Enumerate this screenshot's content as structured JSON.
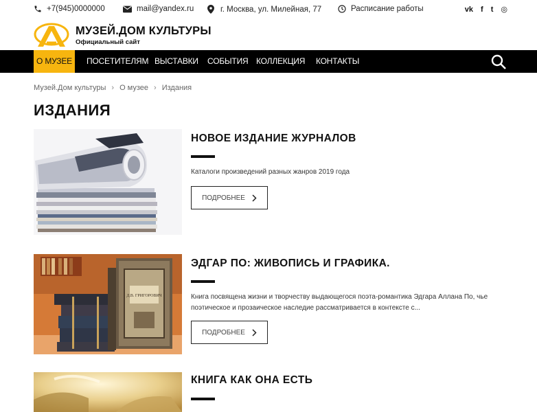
{
  "contacts": {
    "phone": "+7(945)0000000",
    "email": "mail@yandex.ru",
    "address": "г. Москва, ул. Милейная, 77",
    "schedule": "Расписание работы"
  },
  "social": [
    "vk-icon",
    "facebook-icon",
    "twitter-icon",
    "instagram-icon"
  ],
  "social_glyphs": {
    "vk": "vk",
    "fb": "f",
    "tw": "t",
    "ig": "◎"
  },
  "logo": {
    "title": "МУЗЕЙ.ДОМ КУЛЬТУРЫ",
    "subtitle": "Официальный сайт",
    "accent_color": "#f7b50f"
  },
  "nav": {
    "items": [
      {
        "label": "О МУЗЕЕ",
        "active": true
      },
      {
        "label": "ПОСЕТИТЕЛЯМ",
        "active": false
      },
      {
        "label": "ВЫСТАВКИ",
        "active": false
      },
      {
        "label": "СОБЫТИЯ",
        "active": false
      },
      {
        "label": "КОЛЛЕКЦИЯ",
        "active": false
      },
      {
        "label": "КОНТАКТЫ",
        "active": false
      }
    ],
    "search_icon": "search-icon"
  },
  "breadcrumbs": [
    "Музей.Дом культуры",
    "О музее",
    "Издания"
  ],
  "page_title": "ИЗДАНИЯ",
  "cards": [
    {
      "title": "НОВОЕ ИЗДАНИЕ ЖУРНАЛОВ",
      "description": "Каталоги произведений разных жанров 2019 года",
      "button": "ПОДРОБНЕЕ"
    },
    {
      "title": "ЭДГАР ПО: ЖИВОПИСЬ И ГРАФИКА.",
      "description": "Книга посвящена жизни и творчеству выдающегося поэта-романтика Эдгара Аллана По, чье поэтическое и прозаическое наследие рассматривается в контексте с...",
      "button": "ПОДРОБНЕЕ"
    },
    {
      "title": "КНИГА КАК ОНА ЕСТЬ",
      "description": "",
      "button": ""
    }
  ],
  "book_cover_text": "Д.В. ГРИГОРОВИЧ"
}
